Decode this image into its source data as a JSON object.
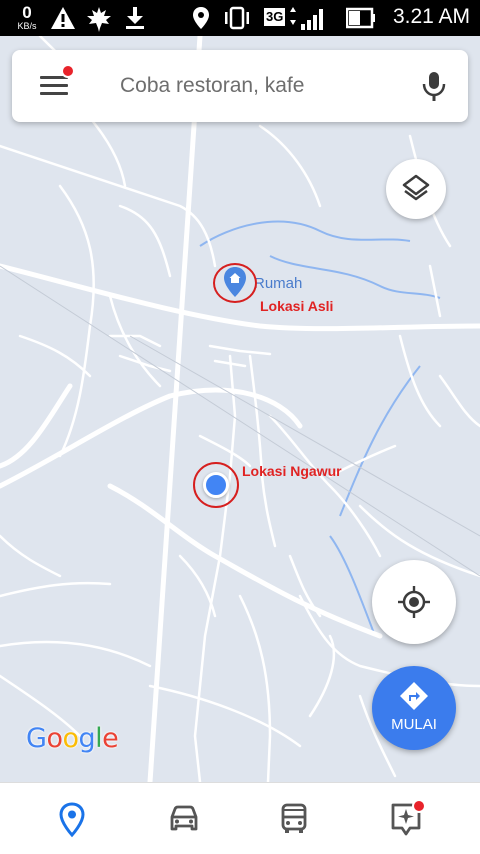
{
  "status_bar": {
    "net_speed": "0",
    "net_unit": "KB/s",
    "network_type": "3G",
    "time": "3.21 AM",
    "icons": [
      "warning-icon",
      "leaf-icon",
      "download-icon",
      "location-icon",
      "vibrate-icon",
      "signal-icon",
      "battery-icon"
    ]
  },
  "search": {
    "placeholder": "Coba restoran, kafe"
  },
  "map": {
    "home_label": "Rumah",
    "annotation_original": "Lokasi Asli",
    "annotation_fake": "Lokasi Ngawur",
    "attribution": "Google"
  },
  "buttons": {
    "start_label": "MULAI"
  },
  "bottom_nav": {
    "items": [
      "explore-icon",
      "driving-icon",
      "transit-icon",
      "updates-icon"
    ]
  },
  "colors": {
    "accent_blue": "#3b7ced",
    "annotation_red": "#e02323",
    "map_background": "#dfe5ee",
    "road_white": "#ffffff",
    "water_blue": "#8fb6f0"
  }
}
